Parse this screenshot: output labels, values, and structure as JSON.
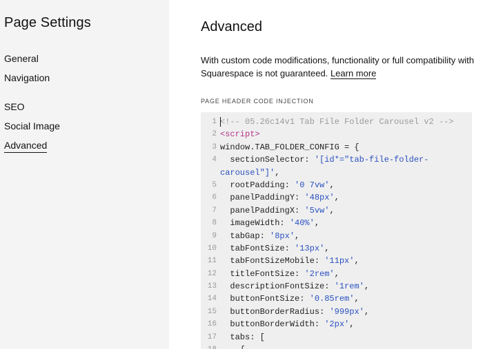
{
  "sidebar": {
    "title": "Page Settings",
    "items": [
      {
        "label": "General",
        "name": "sidebar-item-general",
        "active": false
      },
      {
        "label": "Navigation",
        "name": "sidebar-item-navigation",
        "active": false
      },
      {
        "label": "SEO",
        "name": "sidebar-item-seo",
        "active": false
      },
      {
        "label": "Social Image",
        "name": "sidebar-item-social-image",
        "active": false
      },
      {
        "label": "Advanced",
        "name": "sidebar-item-advanced",
        "active": true
      }
    ]
  },
  "main": {
    "title": "Advanced",
    "description": "With custom code modifications, functionality or full compatibility with Squarespace is not guaranteed.",
    "learn_more": "Learn more",
    "code_label": "PAGE HEADER CODE INJECTION",
    "code_lines": [
      {
        "n": "1",
        "parts": [
          {
            "t": "<!-- 05.26c14v1 Tab File Folder Carousel v2 -->",
            "c": "cmt"
          }
        ]
      },
      {
        "n": "2",
        "parts": [
          {
            "t": "<script>",
            "c": "tag"
          }
        ]
      },
      {
        "n": "3",
        "parts": [
          {
            "t": "window.TAB_FOLDER_CONFIG = {",
            "c": ""
          }
        ]
      },
      {
        "n": "4",
        "parts": [
          {
            "t": "  sectionSelector: ",
            "c": ""
          },
          {
            "t": "'[id*=\"tab-file-folder-",
            "c": "str"
          }
        ]
      },
      {
        "n": "",
        "parts": [
          {
            "t": "carousel\"]'",
            "c": "str"
          },
          {
            "t": ",",
            "c": ""
          }
        ]
      },
      {
        "n": "5",
        "parts": [
          {
            "t": "  rootPadding: ",
            "c": ""
          },
          {
            "t": "'0 7vw'",
            "c": "str"
          },
          {
            "t": ",",
            "c": ""
          }
        ]
      },
      {
        "n": "6",
        "parts": [
          {
            "t": "  panelPaddingY: ",
            "c": ""
          },
          {
            "t": "'48px'",
            "c": "str"
          },
          {
            "t": ",",
            "c": ""
          }
        ]
      },
      {
        "n": "7",
        "parts": [
          {
            "t": "  panelPaddingX: ",
            "c": ""
          },
          {
            "t": "'5vw'",
            "c": "str"
          },
          {
            "t": ",",
            "c": ""
          }
        ]
      },
      {
        "n": "8",
        "parts": [
          {
            "t": "  imageWidth: ",
            "c": ""
          },
          {
            "t": "'40%'",
            "c": "str"
          },
          {
            "t": ",",
            "c": ""
          }
        ]
      },
      {
        "n": "9",
        "parts": [
          {
            "t": "  tabGap: ",
            "c": ""
          },
          {
            "t": "'8px'",
            "c": "str"
          },
          {
            "t": ",",
            "c": ""
          }
        ]
      },
      {
        "n": "10",
        "parts": [
          {
            "t": "  tabFontSize: ",
            "c": ""
          },
          {
            "t": "'13px'",
            "c": "str"
          },
          {
            "t": ",",
            "c": ""
          }
        ]
      },
      {
        "n": "11",
        "parts": [
          {
            "t": "  tabFontSizeMobile: ",
            "c": ""
          },
          {
            "t": "'11px'",
            "c": "str"
          },
          {
            "t": ",",
            "c": ""
          }
        ]
      },
      {
        "n": "12",
        "parts": [
          {
            "t": "  titleFontSize: ",
            "c": ""
          },
          {
            "t": "'2rem'",
            "c": "str"
          },
          {
            "t": ",",
            "c": ""
          }
        ]
      },
      {
        "n": "13",
        "parts": [
          {
            "t": "  descriptionFontSize: ",
            "c": ""
          },
          {
            "t": "'1rem'",
            "c": "str"
          },
          {
            "t": ",",
            "c": ""
          }
        ]
      },
      {
        "n": "14",
        "parts": [
          {
            "t": "  buttonFontSize: ",
            "c": ""
          },
          {
            "t": "'0.85rem'",
            "c": "str"
          },
          {
            "t": ",",
            "c": ""
          }
        ]
      },
      {
        "n": "15",
        "parts": [
          {
            "t": "  buttonBorderRadius: ",
            "c": ""
          },
          {
            "t": "'999px'",
            "c": "str"
          },
          {
            "t": ",",
            "c": ""
          }
        ]
      },
      {
        "n": "16",
        "parts": [
          {
            "t": "  buttonBorderWidth: ",
            "c": ""
          },
          {
            "t": "'2px'",
            "c": "str"
          },
          {
            "t": ",",
            "c": ""
          }
        ]
      },
      {
        "n": "17",
        "parts": [
          {
            "t": "  tabs: [",
            "c": ""
          }
        ]
      },
      {
        "n": "18",
        "parts": [
          {
            "t": "    {",
            "c": ""
          }
        ]
      }
    ]
  },
  "colors": {
    "sidebar_bg": "#f4f4f4",
    "editor_bg": "#efefef",
    "string": "#2a51c0",
    "tag": "#b5338a",
    "comment": "#9a9a9a"
  }
}
